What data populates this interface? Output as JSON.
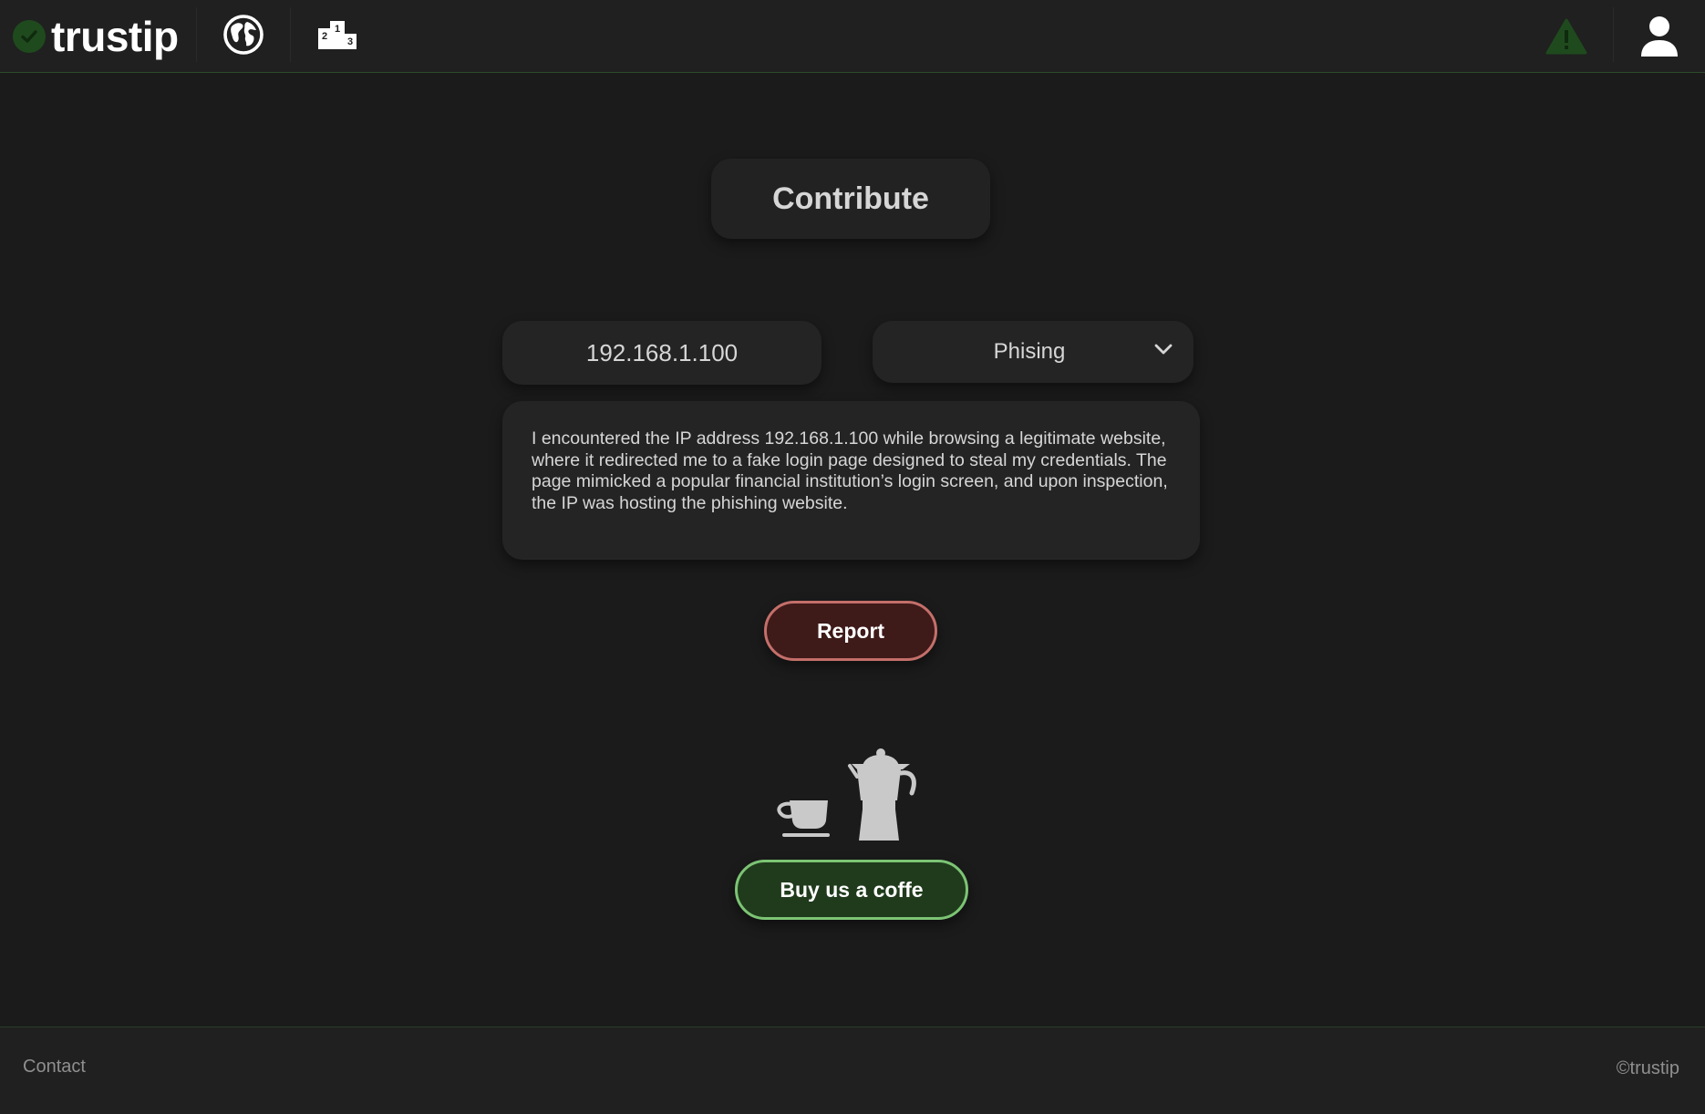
{
  "header": {
    "logo_text": "trustip",
    "icons": [
      "check-icon",
      "globe-icon",
      "podium-icon",
      "warning-icon",
      "user-icon"
    ],
    "accent_color": "#1f4a1e"
  },
  "main": {
    "title": "Contribute",
    "ip_field": {
      "value": "192.168.1.100"
    },
    "threat_type": {
      "selected": "Phising"
    },
    "description": "I encountered the IP address 192.168.1.100 while browsing a legitimate website, where it redirected me to a fake login page designed to steal my credentials. The page mimicked a popular financial institution’s login screen, and upon inspection, the IP was hosting the phishing website.",
    "report_label": "Report",
    "report_color": "#c46f6a",
    "coffee_label": "Buy us a coffe",
    "coffee_color": "#7cc474"
  },
  "footer": {
    "contact_label": "Contact",
    "copyright": "©trustip"
  }
}
